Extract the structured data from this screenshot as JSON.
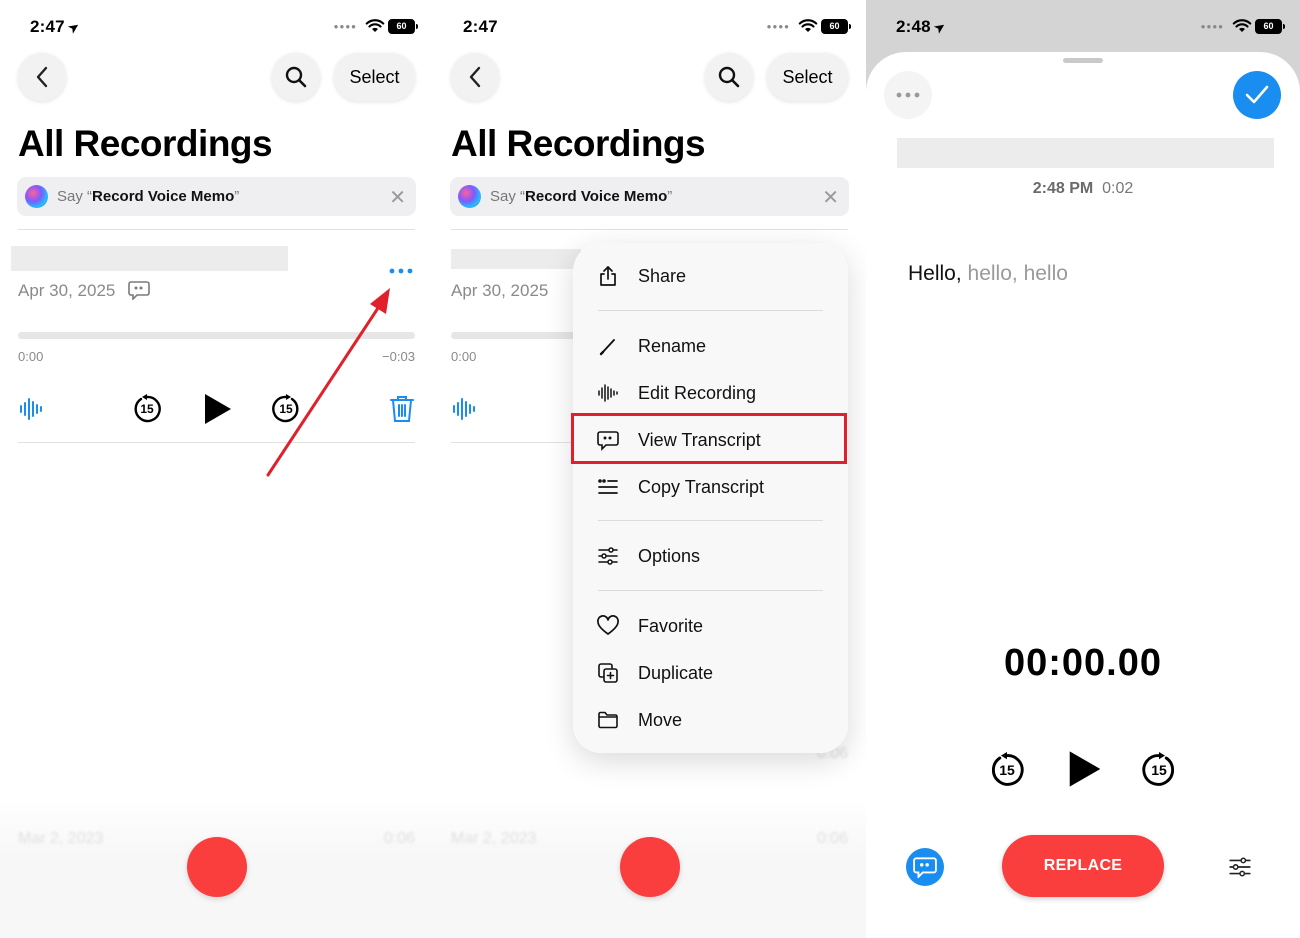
{
  "panel1": {
    "status_time": "2:47",
    "battery": "60",
    "select_label": "Select",
    "title": "All Recordings",
    "siri_prefix": "Say “",
    "siri_phrase": "Record Voice Memo",
    "siri_suffix": "”",
    "recording_date": "Apr 30, 2025",
    "time_start": "0:00",
    "time_end": "−0:03",
    "skip_back": "15",
    "skip_fwd": "15",
    "faded_date": "Mar 2, 2023",
    "faded_duration": "0:06"
  },
  "panel2": {
    "status_time": "2:47",
    "battery": "60",
    "select_label": "Select",
    "title": "All Recordings",
    "siri_prefix": "Say “",
    "siri_phrase": "Record Voice Memo",
    "siri_suffix": "”",
    "recording_date": "Apr 30, 2025",
    "time_start": "0:00",
    "faded_date": "Mar 2, 2023",
    "faded_duration": "0:06",
    "faded_duration_mid": "0:06",
    "menu": {
      "share": "Share",
      "rename": "Rename",
      "edit_recording": "Edit Recording",
      "view_transcript": "View Transcript",
      "copy_transcript": "Copy Transcript",
      "options": "Options",
      "favorite": "Favorite",
      "duplicate": "Duplicate",
      "move": "Move"
    }
  },
  "panel3": {
    "status_time": "2:48",
    "battery": "60",
    "rec_time": "2:48 PM",
    "rec_duration": "0:02",
    "transcript_first": "Hello,",
    "transcript_rest": " hello, hello",
    "timer": "00:00.00",
    "skip_back": "15",
    "skip_fwd": "15",
    "replace_label": "REPLACE"
  },
  "colors": {
    "accent_blue": "#1a8df0",
    "record_red": "#fa3d3d",
    "highlight_red": "#e0202a"
  }
}
